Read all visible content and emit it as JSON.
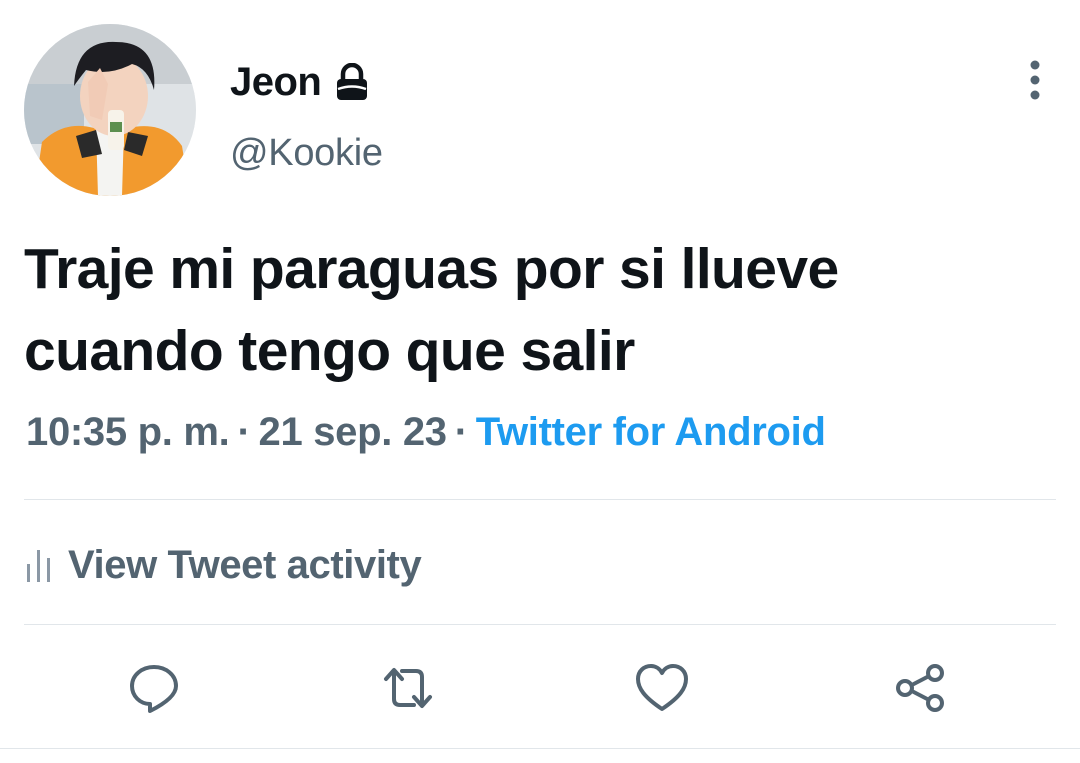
{
  "user": {
    "display_name": "Jeon",
    "handle": "@Kookie",
    "protected_icon": "lock-icon",
    "avatar_icon": "profile-photo"
  },
  "tweet": {
    "text_line1": "Traje mi paraguas por si llueve",
    "text_line2": "cuando tengo que salir",
    "time": "10:35 p. m.",
    "separator": "·",
    "date": "21 sep. 23",
    "source": "Twitter for Android"
  },
  "activity": {
    "label": "View Tweet activity",
    "icon": "bar-chart-icon"
  },
  "actions": {
    "reply_icon": "reply-icon",
    "retweet_icon": "retweet-icon",
    "like_icon": "heart-icon",
    "share_icon": "share-icon",
    "more_icon": "more-vertical-icon"
  },
  "colors": {
    "text": "#0f1419",
    "secondary": "#536471",
    "link": "#1d9bf0",
    "divider": "#e1e6ea"
  }
}
